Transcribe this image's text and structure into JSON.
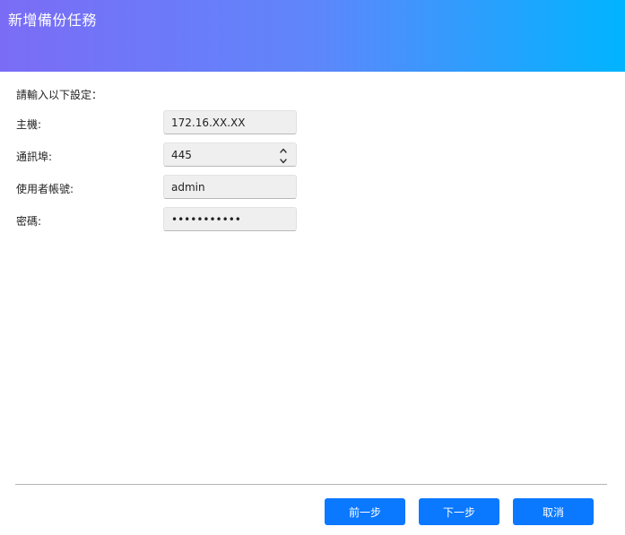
{
  "header": {
    "title": "新增備份任務"
  },
  "form": {
    "instruction": "請輸入以下設定：",
    "host_label": "主機:",
    "host_value": "172.16.XX.XX",
    "port_label": "通訊埠:",
    "port_value": "445",
    "username_label": "使用者帳號:",
    "username_value": "admin",
    "password_label": "密碼:",
    "password_value": "•••••••••••"
  },
  "footer": {
    "back_label": "前一步",
    "next_label": "下一步",
    "cancel_label": "取消"
  },
  "colors": {
    "header_gradient_start": "#7b6cf6",
    "header_gradient_end": "#00b4ff",
    "button_primary": "#0a78ff"
  },
  "icons": {
    "port_stepper_up": "chevron-up-icon",
    "port_stepper_down": "chevron-down-icon"
  }
}
